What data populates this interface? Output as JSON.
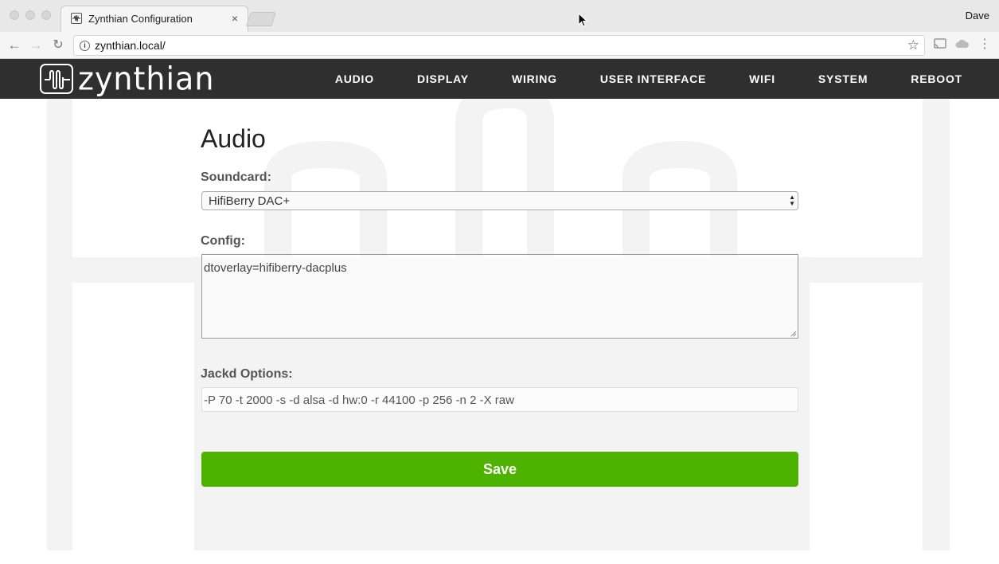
{
  "browser": {
    "tab_title": "Zynthian Configuration",
    "tab_close": "×",
    "profile_name": "Dave",
    "url": "zynthian.local/",
    "icons": [
      "back-icon",
      "forward-icon",
      "reload-icon",
      "info-icon",
      "star-icon",
      "cast-icon",
      "cloud-icon",
      "menu-icon"
    ]
  },
  "site": {
    "logo_text": "zynthian",
    "nav": [
      "AUDIO",
      "DISPLAY",
      "WIRING",
      "USER INTERFACE",
      "WIFI",
      "SYSTEM",
      "REBOOT"
    ],
    "header_color": "#2f2f2f"
  },
  "audio_form": {
    "title": "Audio",
    "soundcard_label": "Soundcard:",
    "soundcard_value": "HifiBerry DAC+",
    "config_label": "Config:",
    "config_value": "dtoverlay=hifiberry-dacplus",
    "jackd_label": "Jackd Options:",
    "jackd_value": "-P 70 -t 2000 -s -d alsa -d hw:0 -r 44100 -p 256 -n 2 -X raw",
    "save_label": "Save",
    "save_color": "#4db300"
  }
}
